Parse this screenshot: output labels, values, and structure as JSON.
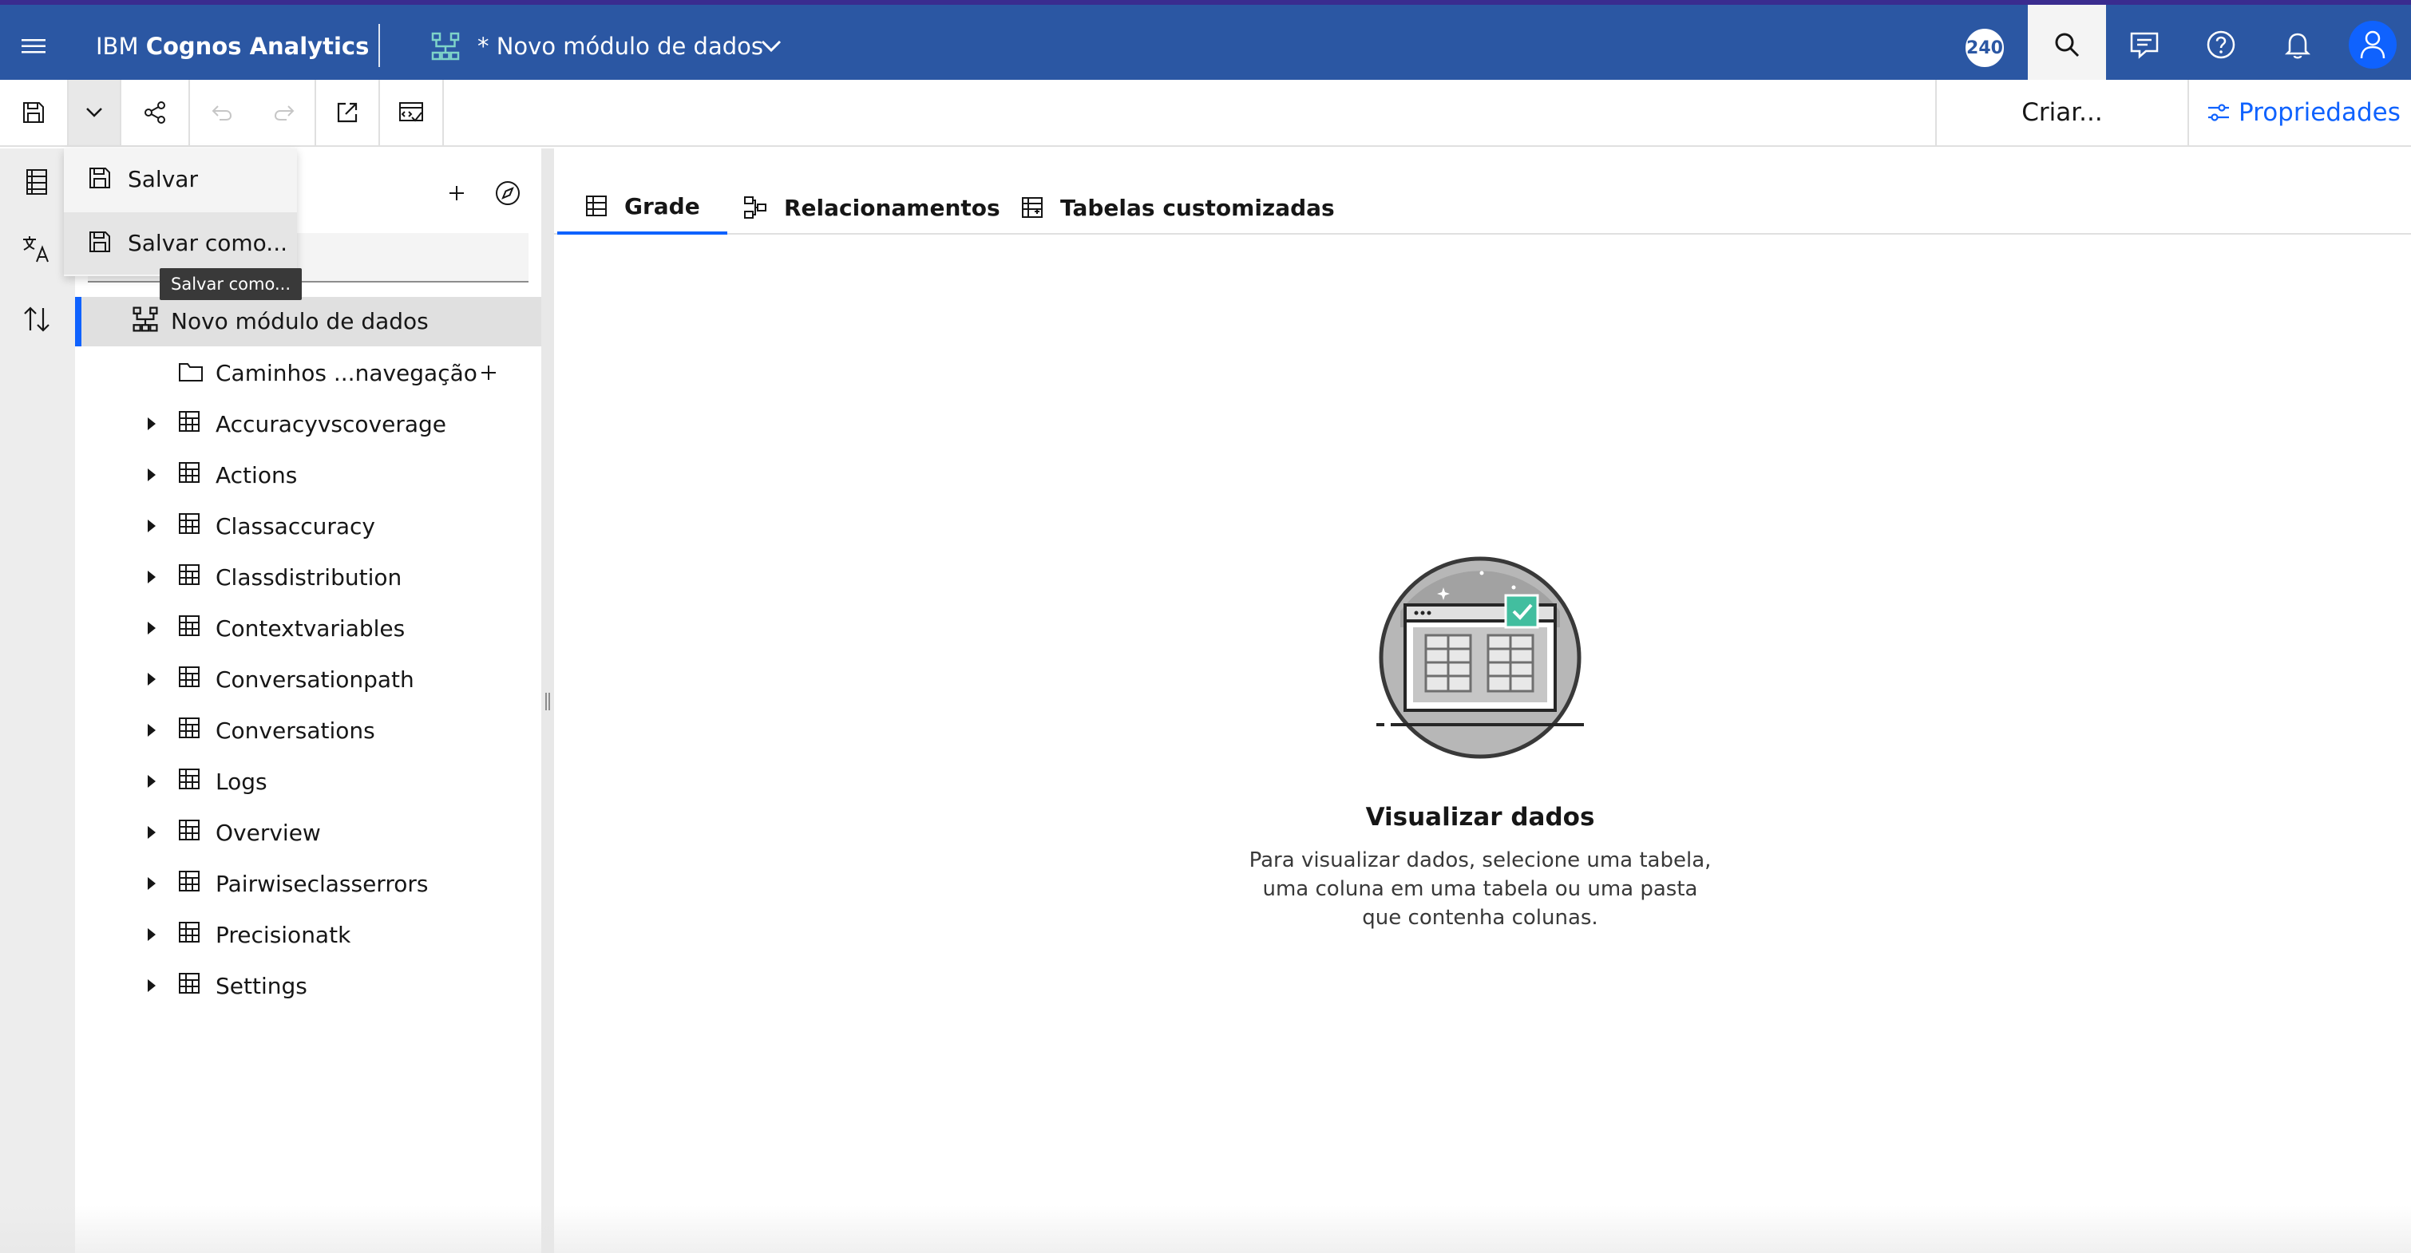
{
  "header": {
    "brand_prefix": "IBM ",
    "brand_name": "Cognos Analytics",
    "module_title": "* Novo módulo de dados",
    "badge_count": "240"
  },
  "toolbar": {
    "create_label": "Criar...",
    "properties_label": "Propriedades"
  },
  "save_menu": {
    "items": [
      {
        "label": "Salvar"
      },
      {
        "label": "Salvar como..."
      }
    ],
    "tooltip": "Salvar como..."
  },
  "tree": {
    "root_label": "Novo módulo de dados",
    "nav_paths_label": "Caminhos ...navegação",
    "tables": [
      "Accuracyvscoverage",
      "Actions",
      "Classaccuracy",
      "Classdistribution",
      "Contextvariables",
      "Conversationpath",
      "Conversations",
      "Logs",
      "Overview",
      "Pairwiseclasserrors",
      "Precisionatk",
      "Settings"
    ]
  },
  "main": {
    "tabs": [
      {
        "label": "Grade",
        "icon": "grid-icon",
        "active": true
      },
      {
        "label": "Relacionamentos",
        "icon": "relationships-icon",
        "active": false
      },
      {
        "label": "Tabelas customizadas",
        "icon": "custom-table-icon",
        "active": false
      }
    ],
    "empty_title": "Visualizar dados",
    "empty_description": "Para visualizar dados, selecione uma tabela, uma coluna em uma tabela ou uma pasta que contenha colunas."
  },
  "colors": {
    "header_bg": "#2b57a3",
    "accent": "#0f62fe",
    "success_check": "#42be9f"
  }
}
